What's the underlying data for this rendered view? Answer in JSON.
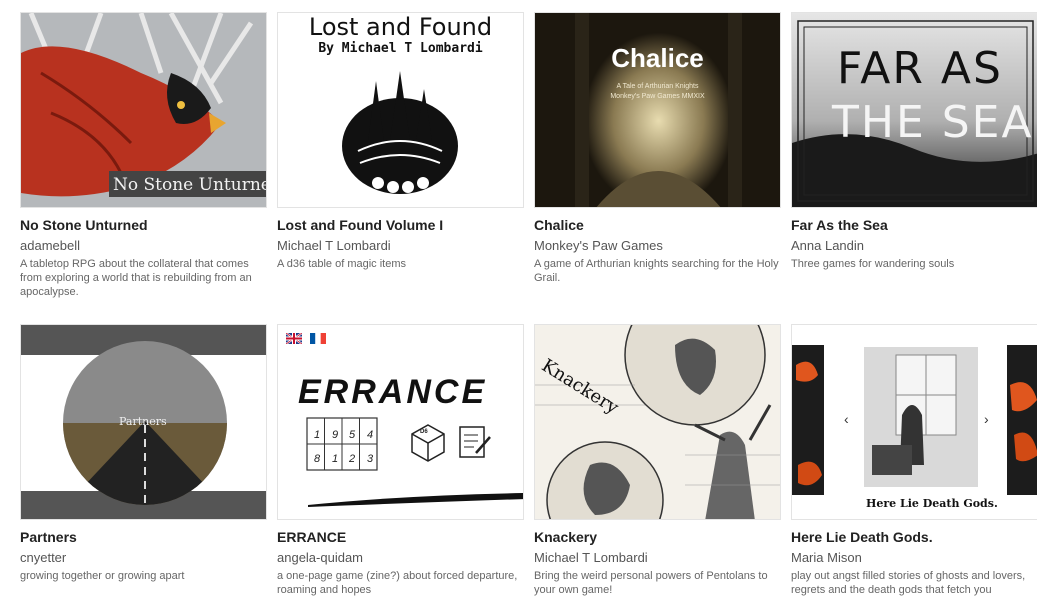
{
  "games": [
    {
      "title": "No Stone Unturned",
      "author": "adamebell",
      "description": "A tabletop RPG about the collateral that comes from exploring a world that is rebuilding from an apocalypse.",
      "cover_text": "No Stone Unturned"
    },
    {
      "title": "Lost and Found Volume I",
      "author": "Michael T Lombardi",
      "description": "A d36 table of magic items",
      "cover_title": "Lost and Found",
      "cover_byline": "By Michael T Lombardi"
    },
    {
      "title": "Chalice",
      "author": "Monkey's Paw Games",
      "description": "A game of Arthurian knights searching for the Holy Grail.",
      "cover_title": "Chalice",
      "cover_sub1": "A Tale of Arthurian Knights",
      "cover_sub2": "Monkey's Paw Games MMXIX"
    },
    {
      "title": "Far As the Sea",
      "author": "Anna Landin",
      "description": "Three games for wandering souls",
      "cover_line1": "FAR AS",
      "cover_line2": "THE SEA"
    },
    {
      "title": "Partners",
      "author": "cnyetter",
      "description": "growing together or growing apart",
      "cover_text": "Partners"
    },
    {
      "title": "ERRANCE",
      "author": "angela-quidam",
      "description": "a one-page game (zine?) about forced departure, roaming and hopes",
      "cover_title": "ERRANCE",
      "grid_numbers": [
        "1",
        "9",
        "5",
        "4",
        "8",
        "1",
        "2",
        "3"
      ],
      "die_label": "D6"
    },
    {
      "title": "Knackery",
      "author": "Michael T Lombardi",
      "description": "Bring the weird personal powers of Pentolans to your own game!",
      "cover_title": "Knackery"
    },
    {
      "title": "Here Lie Death Gods.",
      "author": "Maria Mison",
      "description": "play out angst filled stories of ghosts and lovers, regrets and the death gods that fetch you",
      "cover_text": "Here Lie Death Gods.",
      "arrow_left": "‹",
      "arrow_right": "›"
    }
  ]
}
